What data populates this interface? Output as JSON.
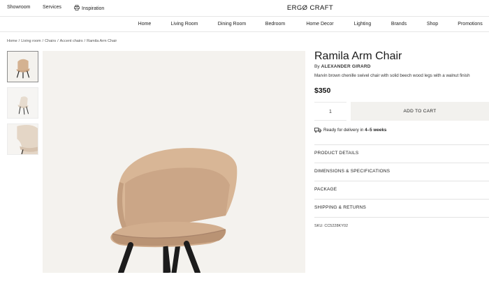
{
  "topbar": {
    "links": [
      {
        "label": "Showroom",
        "icon": ""
      },
      {
        "label": "Services",
        "icon": ""
      },
      {
        "label": "Inspiration",
        "icon": "printer-icon"
      }
    ],
    "logo": "ERGØ CRAFT"
  },
  "nav": {
    "items": [
      "Home",
      "Living Room",
      "Dining Room",
      "Bedroom",
      "Home Decor",
      "Lighting",
      "Brands",
      "Shop",
      "Promotions"
    ]
  },
  "breadcrumb": [
    "Home",
    "Living room",
    "Chairs",
    "Accent chairs",
    "Ramila Arm Chair"
  ],
  "gallery": {
    "thumbnails": [
      "chair-front-thumbnail",
      "chair-side-thumbnail",
      "chair-detail-thumbnail"
    ]
  },
  "product": {
    "title": "Ramila Arm Chair",
    "by_prefix": "By",
    "designer": "ALEXANDER GIRARD",
    "description": "Marvin brown chenille swivel chair with solid beech wood legs with a walnut finish",
    "price": "$350",
    "quantity": "1",
    "add_to_cart": "ADD TO CART",
    "delivery_prefix": "Ready for delivery in",
    "delivery_time": "4–5 weeks",
    "delivery_icon": "truck-icon",
    "accordion": [
      "PRODUCT DETAILS",
      "DIMENSIONS & SPECIFICATIONS",
      "PACKAGE",
      "SHIPPING & RETURNS"
    ],
    "sku": "SKU: CC5228KY02"
  },
  "colors": {
    "upholstery": "#d9b99a",
    "legs": "#1c1c1c",
    "image_bg": "#f4f2ee",
    "button_bg": "#f2f1ee"
  }
}
